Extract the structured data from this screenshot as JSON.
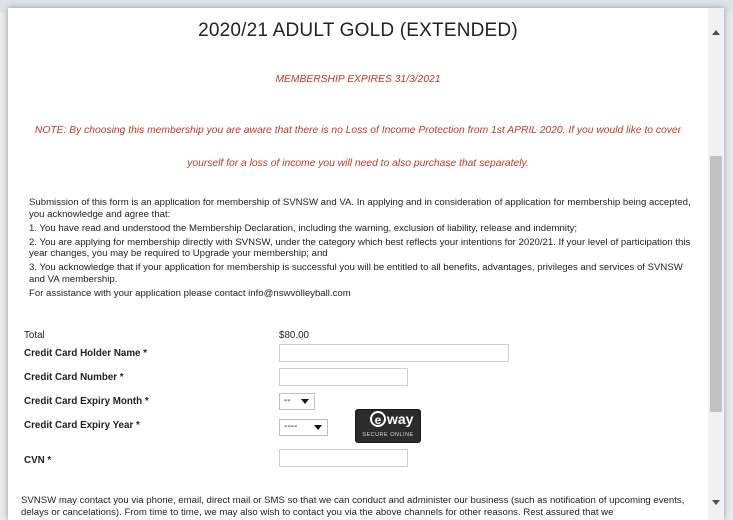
{
  "title": "2020/21 ADULT GOLD (EXTENDED)",
  "expiry": "MEMBERSHIP EXPIRES 31/3/2021",
  "note_line1": "NOTE: By choosing this membership you are aware that there is no Loss of Income Protection from 1st APRIL 2020. If you would like to cover",
  "note_line2": "yourself for a loss of income you will need to also purchase that separately.",
  "declaration": {
    "intro": "Submission of this form is an application for membership of SVNSW and VA. In applying and in consideration of application for membership being accepted, you acknowledge and agree that:",
    "item1": "1. You have read and understood the Membership Declaration, including the warning, exclusion of liability, release and indemnity;",
    "item2": "2. You are applying for membership directly with SVNSW, under the category which best reflects your intentions for 2020/21. If your level of participation this year changes, you may be required to Upgrade your membership; and",
    "item3": "3. You acknowledge that if your application for membership is successful you will be entitled to all benefits, advantages, privileges and services of SVNSW and VA membership.",
    "assist": "For assistance with your application please contact info@nswvolleyball.com"
  },
  "form": {
    "total_label": "Total",
    "total_value": "$80.00",
    "holder_label": "Credit Card Holder Name *",
    "number_label": "Credit Card Number *",
    "expiry_month_label": "Credit Card Expiry Month *",
    "expiry_month_value": "--",
    "expiry_year_label": "Credit Card Expiry Year *",
    "expiry_year_value": "----",
    "cvn_label": "CVN *"
  },
  "eway": {
    "logo": "way",
    "logo_e": "e",
    "sub": "SECURE ONLINE"
  },
  "footer": "SVNSW may contact you via phone, email, direct mail or SMS so that we can conduct and administer our business (such as notification of upcoming events, delays or cancelations). From time to time, we may also wish to contact you via the above channels for other reasons. Rest assured that we",
  "colors": {
    "note_red": "#c0392b",
    "scroll_thumb": "#c1c1c1"
  }
}
